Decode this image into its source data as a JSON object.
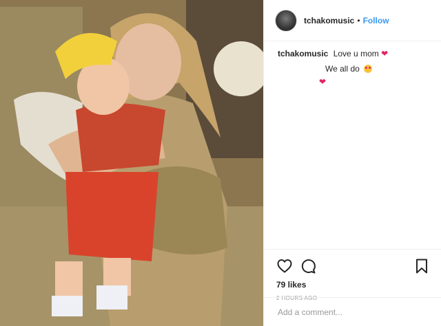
{
  "post": {
    "author": "tchakomusic",
    "separator": "•",
    "follow_label": "Follow",
    "caption_user": "tchakomusic",
    "caption_text": "Love u mom",
    "caption_emoji": "red-heart-icon",
    "comment_text": "We all do",
    "comment_emoji": "heart-eyes-emoji-icon",
    "likes": "79 likes",
    "time": "2 HOURS AGO",
    "comment_placeholder": "Add a comment..."
  },
  "colors": {
    "follow": "#3897f0",
    "heart": "#e0245e"
  }
}
